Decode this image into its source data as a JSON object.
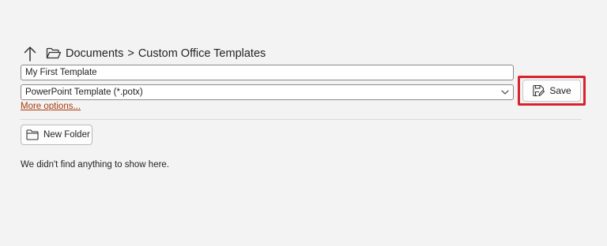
{
  "navigation": {
    "up_icon": "arrow-up-icon",
    "folder_icon": "folder-open-icon",
    "breadcrumb": [
      "Documents",
      "Custom Office Templates"
    ],
    "separator": ">"
  },
  "form": {
    "file_name_value": "My First Template",
    "file_type_selected": "PowerPoint Template (*.potx)",
    "more_options_label": "More options...",
    "save_label": "Save",
    "save_icon": "save-edit-icon",
    "highlight_color": "#d6232c"
  },
  "folder_actions": {
    "new_folder_label": "New Folder",
    "new_folder_icon": "folder-icon"
  },
  "empty_state": {
    "message": "We didn't find anything to show here."
  }
}
